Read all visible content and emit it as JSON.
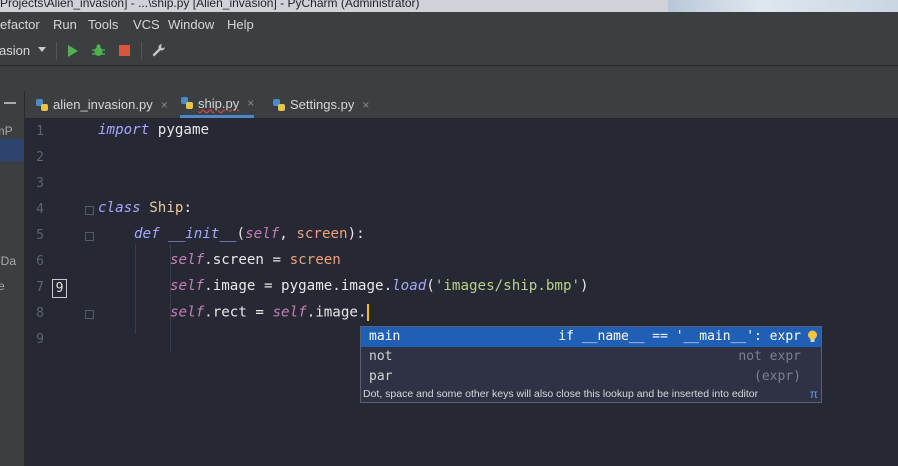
{
  "window": {
    "title": "Projects\\Alien_invasion] - ...\\ship.py [Alien_invasion] - PyCharm (Administrator)"
  },
  "menu": [
    "efactor",
    "Run",
    "Tools",
    "VCS",
    "Window",
    "Help"
  ],
  "toolbar": {
    "config_label": "asion"
  },
  "left_panel": {
    "text1": "armP",
    "text2": "pDa",
    "text3": "e"
  },
  "tabs": [
    {
      "label": "alien_invasion.py",
      "close": "×"
    },
    {
      "label": "ship.py",
      "close": "×"
    },
    {
      "label": "Settings.py",
      "close": "×"
    }
  ],
  "line_numbers": [
    "1",
    "2",
    "3",
    "4",
    "5",
    "6",
    "7",
    "8",
    "9"
  ],
  "code": {
    "l1_kw": "import",
    "l1_rest": " pygame",
    "l4_kw": "class",
    "l4_name": "Ship",
    "l4_colon": ":",
    "l5_kw": "def",
    "l5_fn": "__init__",
    "l5_p1": "(",
    "l5_self": "self",
    "l5_comma": ", ",
    "l5_arg": "screen",
    "l5_p2": "):",
    "l6_self": "self",
    "l6_attr": ".screen",
    "l6_eq": " = ",
    "l6_val": "screen",
    "l7_self": "self",
    "l7_attr": ".image",
    "l7_eq": " = ",
    "l7_mod": "pygame",
    "l7_d1": ".",
    "l7_img": "image",
    "l7_d2": ".",
    "l7_fn": "load",
    "l7_p1": "(",
    "l7_str": "'images/ship.bmp'",
    "l7_p2": ")",
    "l8_self": "self",
    "l8_attr": ".rect",
    "l8_eq": " = ",
    "l8_self2": "self",
    "l8_attr2": ".image",
    "l8_dot": "."
  },
  "popup": {
    "items": [
      {
        "name": "main",
        "desc": "if __name__ == '__main__': expr"
      },
      {
        "name": "not",
        "desc": "not expr"
      },
      {
        "name": "par",
        "desc": "(expr)"
      }
    ],
    "hint": "Dot, space and some other keys will also close this lookup and be inserted into editor",
    "pi": "π"
  },
  "colors": {
    "accent": "#1f5fb5",
    "caret": "#f4c400",
    "editor_bg": "#262833"
  }
}
